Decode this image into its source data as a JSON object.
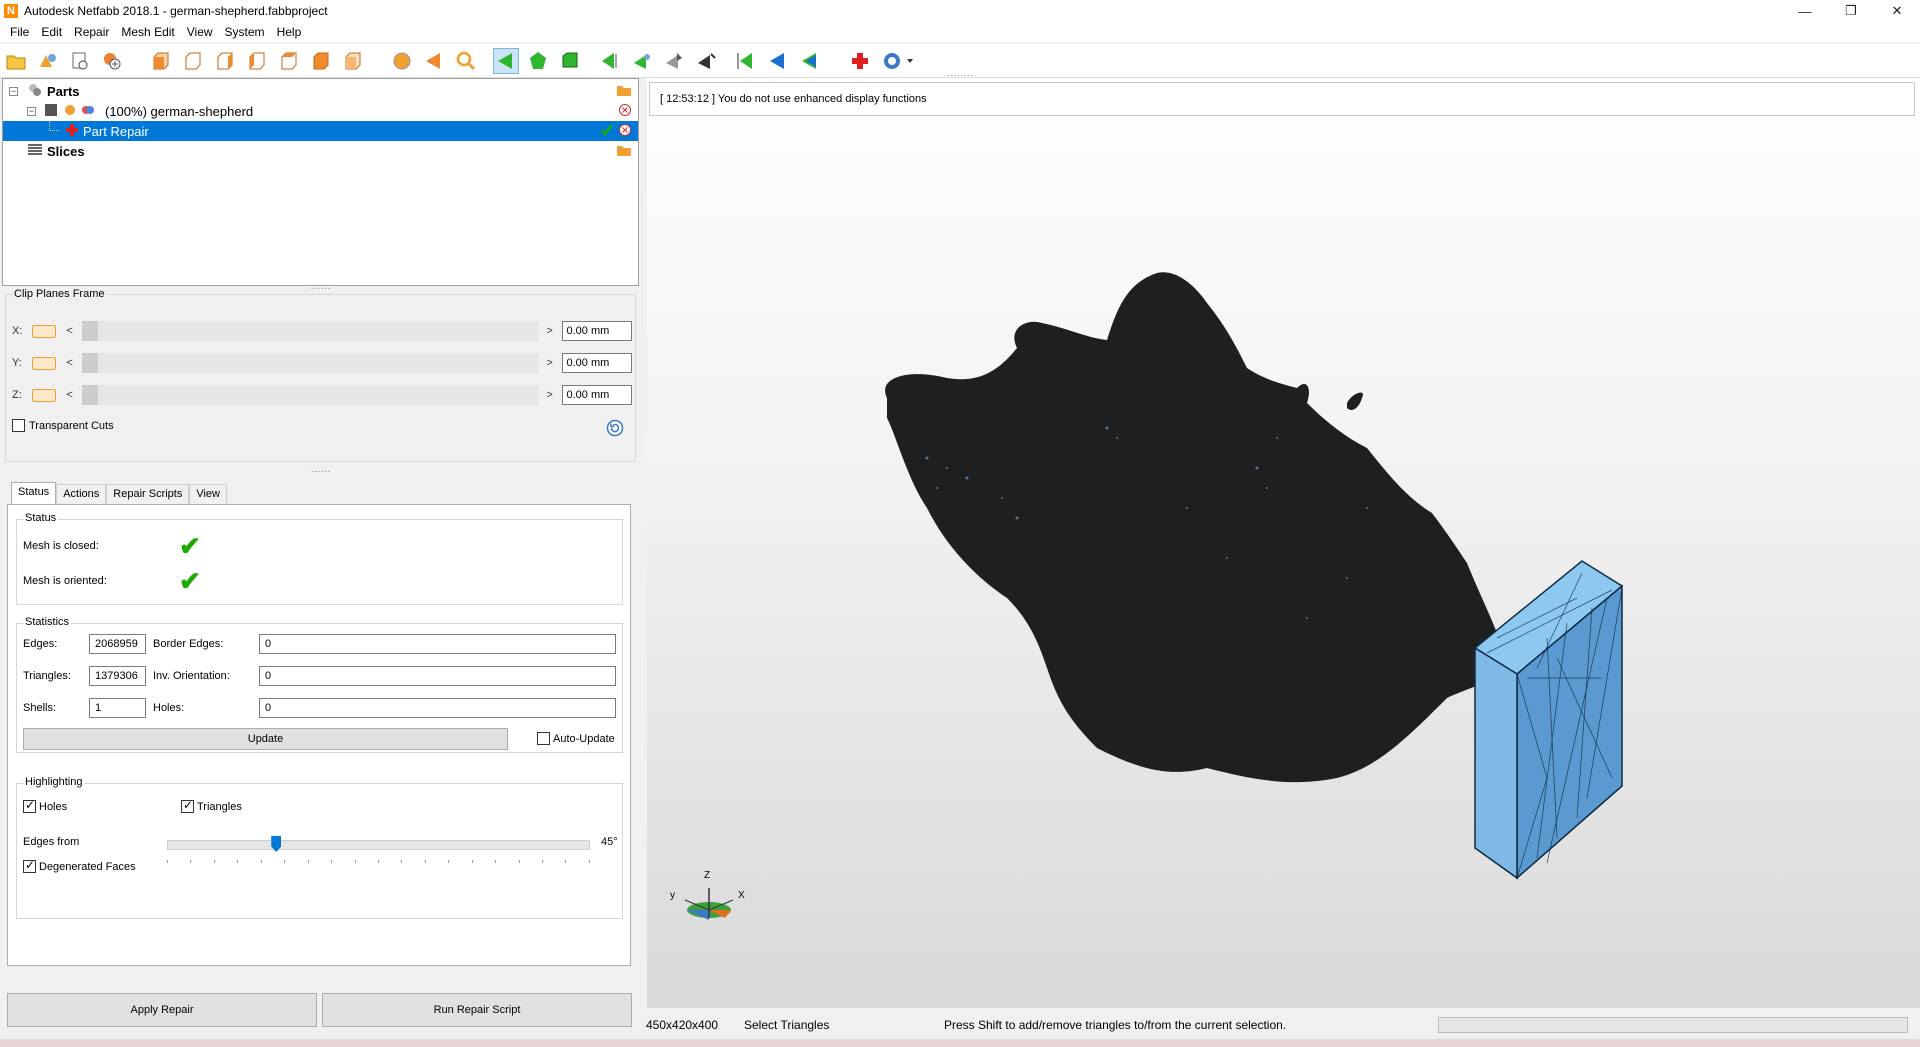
{
  "window": {
    "title": "Autodesk Netfabb 2018.1 - german-shepherd.fabbproject",
    "logo_letter": "N",
    "minimize": "—",
    "restore": "❐",
    "close": "✕"
  },
  "menu": [
    "File",
    "Edit",
    "Repair",
    "Mesh Edit",
    "View",
    "System",
    "Help"
  ],
  "tree": {
    "parts_label": "Parts",
    "part_label": "(100%) german-shepherd",
    "repair_label": "Part Repair",
    "slices_label": "Slices"
  },
  "clip": {
    "title": "Clip Planes Frame",
    "rows": [
      {
        "axis": "X:",
        "value": "0.00 mm"
      },
      {
        "axis": "Y:",
        "value": "0.00 mm"
      },
      {
        "axis": "Z:",
        "value": "0.00 mm"
      }
    ],
    "left_arrow": "<",
    "right_arrow": ">",
    "transparent_label": "Transparent Cuts",
    "transparent_checked": false
  },
  "tabs": [
    "Status",
    "Actions",
    "Repair Scripts",
    "View"
  ],
  "status": {
    "title": "Status",
    "closed_label": "Mesh is closed:",
    "oriented_label": "Mesh is oriented:",
    "closed_ok": true,
    "oriented_ok": true
  },
  "statistics": {
    "title": "Statistics",
    "edges_label": "Edges:",
    "edges": "2068959",
    "border_label": "Border Edges:",
    "border": "0",
    "triangles_label": "Triangles:",
    "triangles": "1379306",
    "inv_label": "Inv. Orientation:",
    "inv": "0",
    "shells_label": "Shells:",
    "shells": "1",
    "holes_label": "Holes:",
    "holes": "0",
    "update_label": "Update",
    "auto_update_label": "Auto-Update",
    "auto_update_checked": false
  },
  "highlighting": {
    "title": "Highlighting",
    "holes_label": "Holes",
    "holes_checked": true,
    "triangles_label": "Triangles",
    "triangles_checked": true,
    "edges_label": "Edges from",
    "edges_value": "45°",
    "edges_angle": 45,
    "degenerated_label": "Degenerated Faces",
    "degenerated_checked": true
  },
  "actions": {
    "apply": "Apply Repair",
    "run_script": "Run Repair Script"
  },
  "viewport": {
    "log": "[ 12:53:12 ] You do not use enhanced display functions",
    "axis_x": "X",
    "axis_y": "y",
    "axis_z": "Z"
  },
  "statusbar": {
    "dimensions": "450x420x400",
    "mode": "Select Triangles",
    "hint": "Press Shift to add/remove triangles to/from the current selection."
  },
  "icons": {
    "toolbar": [
      "open-folder-icon",
      "add-part-icon",
      "new-project-icon",
      "add-icon",
      "view-front-icon",
      "view-back-icon",
      "view-left-icon",
      "view-right-icon",
      "view-top-icon",
      "view-bottom-icon",
      "view-iso-icon",
      "sphere-icon",
      "arrow-left-icon",
      "zoom-icon",
      "select-triangles-icon",
      "select-surface-icon",
      "select-shell-icon",
      "select-plane-icon",
      "select-flip-icon",
      "select-paint-icon",
      "select-lasso-icon",
      "deselect-icon",
      "invert-selection-icon",
      "select-all-icon",
      "repair-cross-icon",
      "help-dropdown-icon"
    ]
  },
  "colors": {
    "selection": "#0078d7",
    "check_green": "#1faa00",
    "clip_orange": "#f0a030",
    "box_blue": "#6fb4e8",
    "mesh_dark": "#1e1f21"
  }
}
